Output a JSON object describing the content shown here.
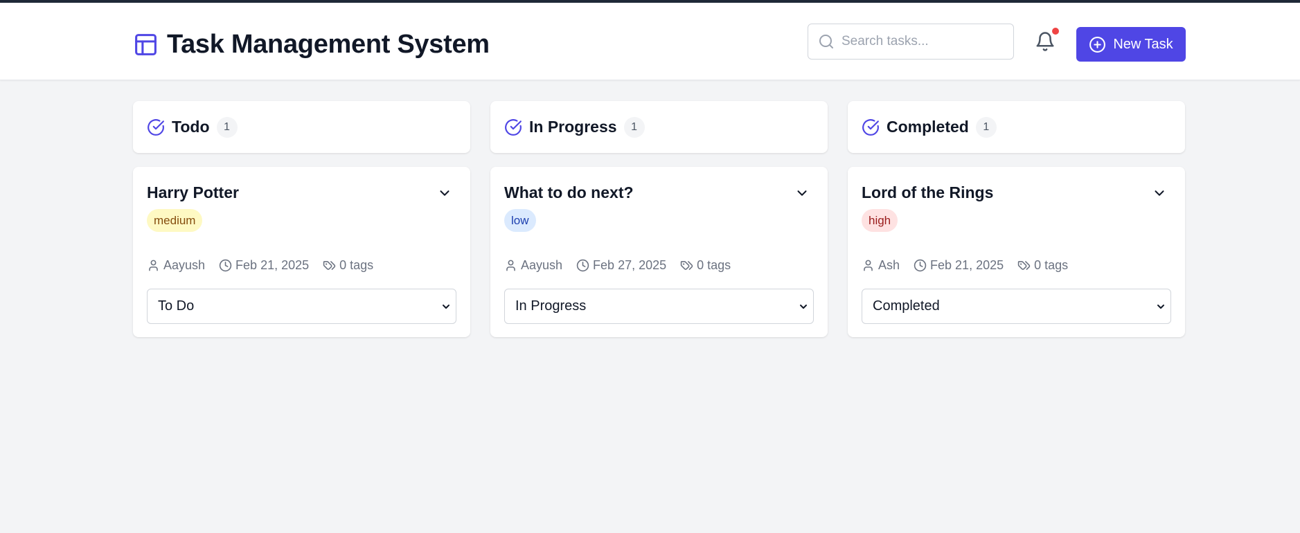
{
  "header": {
    "title": "Task Management System",
    "search_placeholder": "Search tasks...",
    "new_task_label": "New Task",
    "notification_dot_color": "#ef4444",
    "accent_color": "#4f46e5"
  },
  "columns": [
    {
      "title": "Todo",
      "count": "1",
      "card": {
        "title": "Harry Potter",
        "priority": "medium",
        "assignee": "Aayush",
        "date": "Feb 21, 2025",
        "tags": "0 tags",
        "status": "To Do"
      }
    },
    {
      "title": "In Progress",
      "count": "1",
      "card": {
        "title": "What to do next?",
        "priority": "low",
        "assignee": "Aayush",
        "date": "Feb 27, 2025",
        "tags": "0 tags",
        "status": "In Progress"
      }
    },
    {
      "title": "Completed",
      "count": "1",
      "card": {
        "title": "Lord of the Rings",
        "priority": "high",
        "assignee": "Ash",
        "date": "Feb 21, 2025",
        "tags": "0 tags",
        "status": "Completed"
      }
    }
  ],
  "priority_colors": {
    "medium": {
      "bg": "#fef9c3",
      "fg": "#854d0e"
    },
    "low": {
      "bg": "#dbeafe",
      "fg": "#1e40af"
    },
    "high": {
      "bg": "#fee2e2",
      "fg": "#991b1b"
    }
  }
}
